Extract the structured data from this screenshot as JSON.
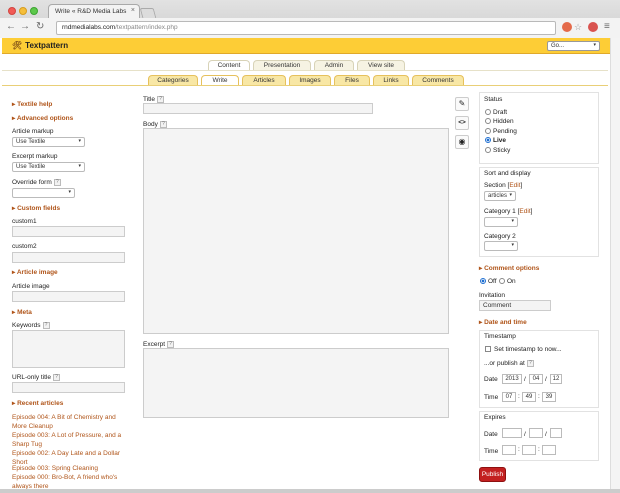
{
  "browser": {
    "tab_title": "Write « R&D Media Labs",
    "tab_close": "×",
    "url_host": "rndmedialabs.com",
    "url_path": "/textpattern/index.php",
    "back": "←",
    "forward": "→",
    "reload": "↻",
    "menu": "≡"
  },
  "app": {
    "logo": "Textpattern",
    "logo_icon": "🛠",
    "go_select": "Go...",
    "go_arrow": "▾"
  },
  "primary_tabs": [
    "Content",
    "Presentation",
    "Admin",
    "View site"
  ],
  "secondary_tabs": [
    "Categories",
    "Write",
    "Articles",
    "Images",
    "Files",
    "Links",
    "Comments"
  ],
  "left": {
    "textile_help": "Textile help",
    "advanced_options": "Advanced options",
    "article_markup_label": "Article markup",
    "article_markup_value": "Use Textile",
    "excerpt_markup_label": "Excerpt markup",
    "excerpt_markup_value": "Use Textile",
    "override_form_label": "Override form",
    "custom_fields": "Custom fields",
    "custom1": "custom1",
    "custom2": "custom2",
    "article_image": "Article image",
    "article_image_label": "Article image",
    "meta": "Meta",
    "keywords_label": "Keywords",
    "url_only_title_label": "URL-only title",
    "recent_articles": "Recent articles",
    "recent": [
      "Episode 004: A Bit of Chemistry and More Cleanup",
      "Episode 003: A Lot of Pressure, and a Sharp Tug",
      "Episode 002: A Day Late and a Dollar Short",
      "Episode 003: Spring Cleaning",
      "Episode 000: Bro-Bot, A friend who's always there"
    ],
    "section_marker": "▸",
    "help_mark": "?"
  },
  "center": {
    "title_label": "Title",
    "body_label": "Body",
    "excerpt_label": "Excerpt",
    "help_mark": "?",
    "icon_edit": "✎",
    "icon_code": "<>",
    "icon_view": "◉"
  },
  "right": {
    "status_title": "Status",
    "statuses": [
      "Draft",
      "Hidden",
      "Pending",
      "Live",
      "Sticky"
    ],
    "selected_status": "Live",
    "sort_display_title": "Sort and display",
    "section_label": "Section",
    "edit_link": "Edit",
    "section_value": "articles",
    "category1_label": "Category 1",
    "category2_label": "Category 2",
    "comment_options": "Comment options",
    "comment_off": "Off",
    "comment_on": "On",
    "invitation_label": "Invitation",
    "invitation_value": "Comment",
    "date_time": "Date and time",
    "timestamp_title": "Timestamp",
    "set_timestamp": "Set timestamp to now...",
    "or_publish_at": "...or publish at",
    "date_label": "Date",
    "time_label": "Time",
    "date_year": "2013",
    "date_month": "04",
    "date_day": "12",
    "time_h": "07",
    "time_m": "49",
    "time_s": "39",
    "expires_title": "Expires",
    "slash": "/",
    "colon": ":",
    "publish_button": "Publish"
  },
  "colors": {
    "header": "#fdcd36",
    "section_heading": "#b0551a",
    "publish": "#c32020"
  }
}
